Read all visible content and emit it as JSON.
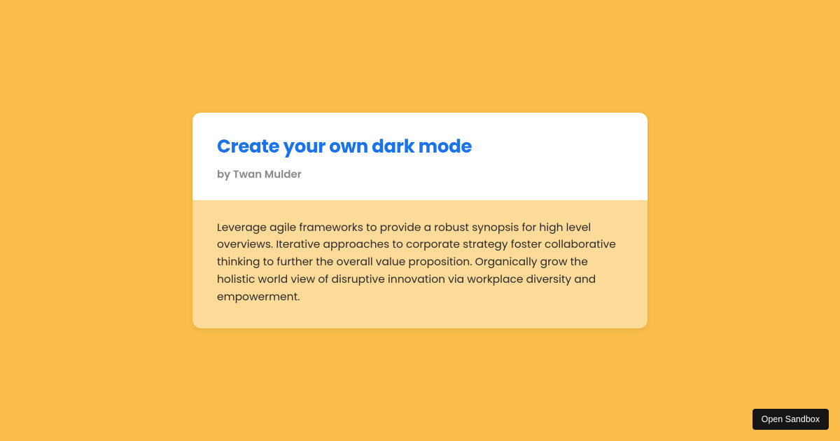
{
  "card": {
    "title": "Create your own dark mode",
    "author": "by Twan Mulder",
    "body": "Leverage agile frameworks to provide a robust synopsis for high level overviews. Iterative approaches to corporate strategy foster collaborative thinking to further the overall value proposition. Organically grow the holistic world view of disruptive innovation via workplace diversity and empowerment."
  },
  "button": {
    "open_sandbox": "Open Sandbox"
  }
}
